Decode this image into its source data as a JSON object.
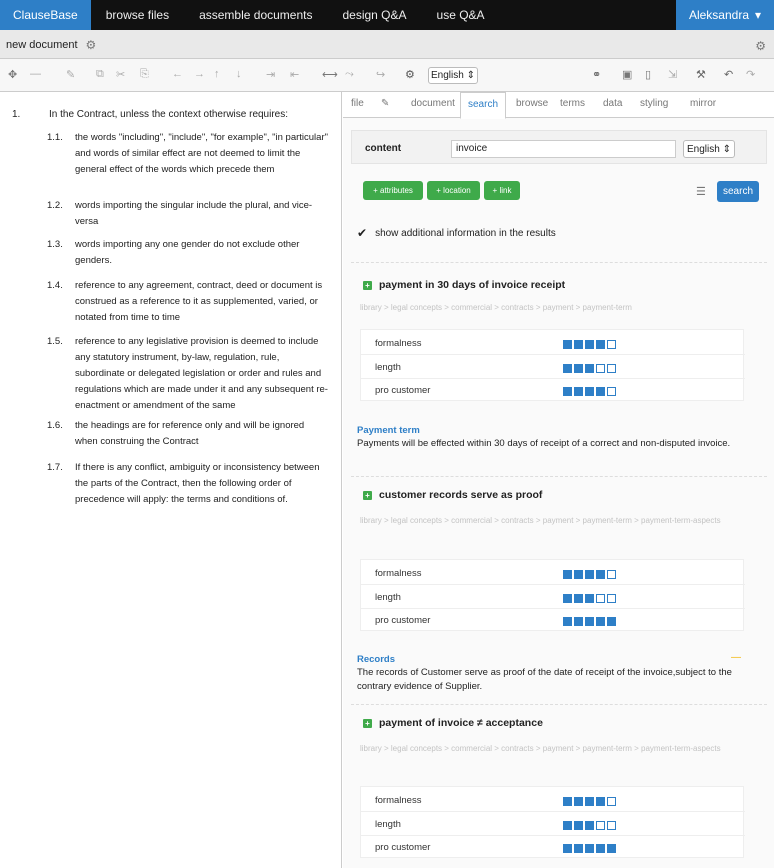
{
  "app": {
    "brand": "ClauseBase",
    "nav": [
      "browse files",
      "assemble documents",
      "design Q&A",
      "use Q&A"
    ],
    "user": "Aleksandra"
  },
  "doc_tab": {
    "title": "new document"
  },
  "toolbar": {
    "language": "English"
  },
  "left": {
    "main_num": "1.",
    "main_text": "In the Contract, unless the context otherwise requires:",
    "subclauses": [
      {
        "num": "1.1.",
        "text": "the words \"including\", \"include\", \"for example\", \"in particular\" and words of similar effect are not deemed to limit the general effect of the words which precede them"
      },
      {
        "num": "1.2.",
        "text": "words importing the singular include the plural, and vice-versa"
      },
      {
        "num": "1.3.",
        "text": "words importing any one gender do not exclude other genders."
      },
      {
        "num": "1.4.",
        "text": "reference to any agreement, contract, deed or document is construed as a reference to it as supplemented, varied, or notated from time to time"
      },
      {
        "num": "1.5.",
        "text": "reference to any legislative provision is deemed to include any statutory instrument, by-law, regulation, rule, subordinate or delegated legislation or order and rules and regulations which are made under it and any subsequent re-enactment or amendment of the same"
      },
      {
        "num": "1.6.",
        "text": "the headings are for reference only and will be ignored when construing the Contract"
      },
      {
        "num": "1.7.",
        "text": "If there is any conflict, ambiguity or inconsistency between the parts of the Contract, then the following order of precedence will apply: the terms and conditions of."
      }
    ]
  },
  "right": {
    "tabs": [
      "file",
      "document",
      "search",
      "browse",
      "terms",
      "data",
      "styling",
      "mirror"
    ],
    "search": {
      "label": "content",
      "value": "invoice",
      "language": "English"
    },
    "filters": [
      "+ attributes",
      "+ location",
      "+ link"
    ],
    "search_button": "search",
    "show_info": "show additional information in the results",
    "results": [
      {
        "title": "payment in 30 days of invoice receipt",
        "path": "library > legal concepts > commercial > contracts > payment > payment-term",
        "ratings": [
          {
            "label": "formalness",
            "value": 4
          },
          {
            "label": "length",
            "value": 3
          },
          {
            "label": "pro customer",
            "value": 4
          }
        ],
        "clause_title": "Payment term",
        "clause_text": "Payments will be effected within 30 days of receipt of a correct and non-disputed invoice."
      },
      {
        "title": "customer records serve as proof",
        "path": "library > legal concepts > commercial > contracts > payment > payment-term > payment-term-aspects",
        "ratings": [
          {
            "label": "formalness",
            "value": 4
          },
          {
            "label": "length",
            "value": 3
          },
          {
            "label": "pro customer",
            "value": 5
          }
        ],
        "clause_title": "Records",
        "clause_text": "The records of Customer serve as proof of the date of receipt of the invoice,subject to the contrary evidence of Supplier."
      },
      {
        "title": "payment of invoice ≠ acceptance",
        "path": "library > legal concepts > commercial > contracts > payment > payment-term > payment-term-aspects",
        "ratings": [
          {
            "label": "formalness",
            "value": 4
          },
          {
            "label": "length",
            "value": 3
          },
          {
            "label": "pro customer",
            "value": 5
          }
        ]
      }
    ],
    "rating_max": 5
  }
}
